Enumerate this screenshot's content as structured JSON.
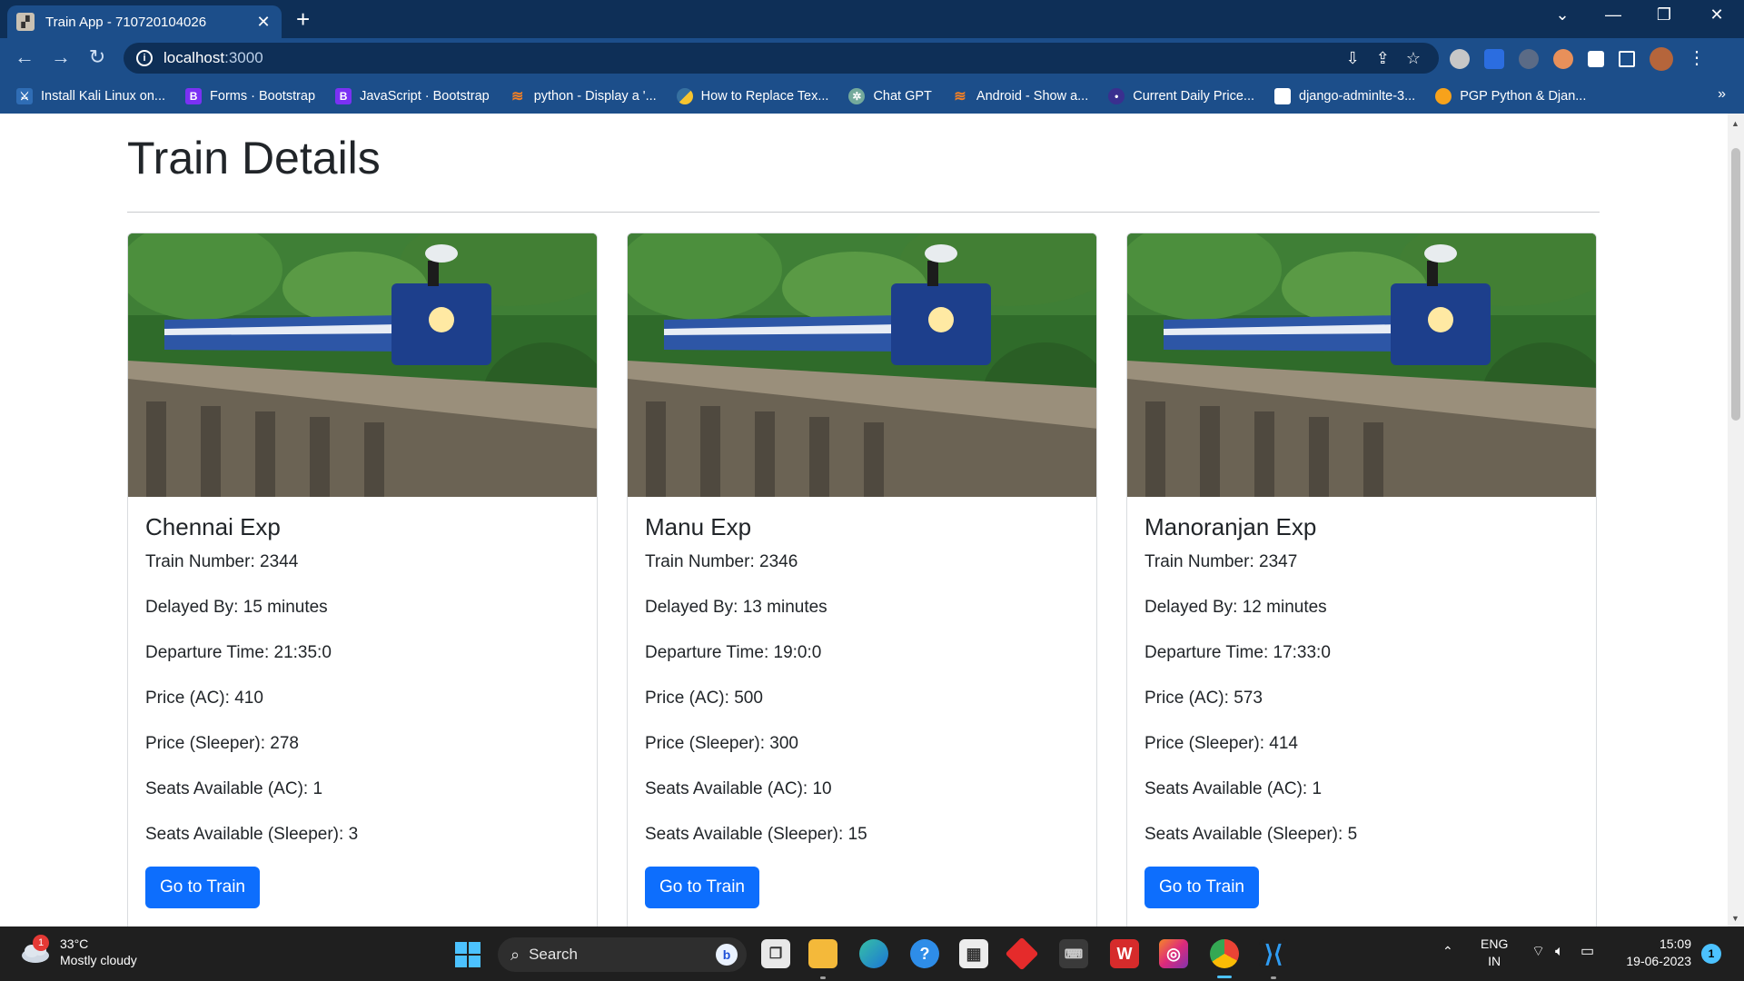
{
  "browser": {
    "tab_title": "Train App - 710720104026",
    "url_host": "localhost",
    "url_port": ":3000"
  },
  "bookmarks": [
    {
      "label": "Install Kali Linux on...",
      "icon": "kali-icon",
      "color": "#2f6db5"
    },
    {
      "label": "Forms · Bootstrap",
      "icon": "B",
      "color": "#7b31f4"
    },
    {
      "label": "JavaScript · Bootstrap",
      "icon": "B",
      "color": "#7b31f4"
    },
    {
      "label": "python - Display a '...",
      "icon": "stack-overflow-icon",
      "color": "#f48024"
    },
    {
      "label": "How to Replace Tex...",
      "icon": "python-icon",
      "color": "#f6c42f"
    },
    {
      "label": "Chat GPT",
      "icon": "chatgpt-icon",
      "color": "#74aa9c"
    },
    {
      "label": "Android - Show a...",
      "icon": "stack-overflow-icon",
      "color": "#f48024"
    },
    {
      "label": "Current Daily Price...",
      "icon": "market-icon",
      "color": "#3a2f8f"
    },
    {
      "label": "django-adminlte-3...",
      "icon": "package-icon",
      "color": "#ffffff"
    },
    {
      "label": "PGP Python & Djan...",
      "icon": "pgp-icon",
      "color": "#f7a21b"
    }
  ],
  "page": {
    "title": "Train Details",
    "labels": {
      "train_number": "Train Number: ",
      "delayed_by": "Delayed By: ",
      "departure": "Departure Time: ",
      "price_ac": "Price (AC): ",
      "price_sleeper": "Price (Sleeper): ",
      "seats_ac": "Seats Available (AC): ",
      "seats_sleeper": "Seats Available (Sleeper): "
    },
    "button_label": "Go to Train",
    "trains": [
      {
        "name": "Chennai Exp",
        "train_number": "2344",
        "delayed_by": "15 minutes",
        "departure": "21:35:0",
        "price_ac": "410",
        "price_sleeper": "278",
        "seats_ac": "1",
        "seats_sleeper": "3"
      },
      {
        "name": "Manu Exp",
        "train_number": "2346",
        "delayed_by": "13 minutes",
        "departure": "19:0:0",
        "price_ac": "500",
        "price_sleeper": "300",
        "seats_ac": "10",
        "seats_sleeper": "15"
      },
      {
        "name": "Manoranjan Exp",
        "train_number": "2347",
        "delayed_by": "12 minutes",
        "departure": "17:33:0",
        "price_ac": "573",
        "price_sleeper": "414",
        "seats_ac": "1",
        "seats_sleeper": "5"
      }
    ]
  },
  "taskbar": {
    "weather_temp": "33°C",
    "weather_desc": "Mostly cloudy",
    "weather_badge": "1",
    "search_label": "Search",
    "lang_top": "ENG",
    "lang_bottom": "IN",
    "time": "15:09",
    "date": "19-06-2023",
    "notifications": "1"
  },
  "colors": {
    "accent": "#0d6efd",
    "chrome_dark": "#0e2f57",
    "chrome": "#1c4e8a"
  }
}
